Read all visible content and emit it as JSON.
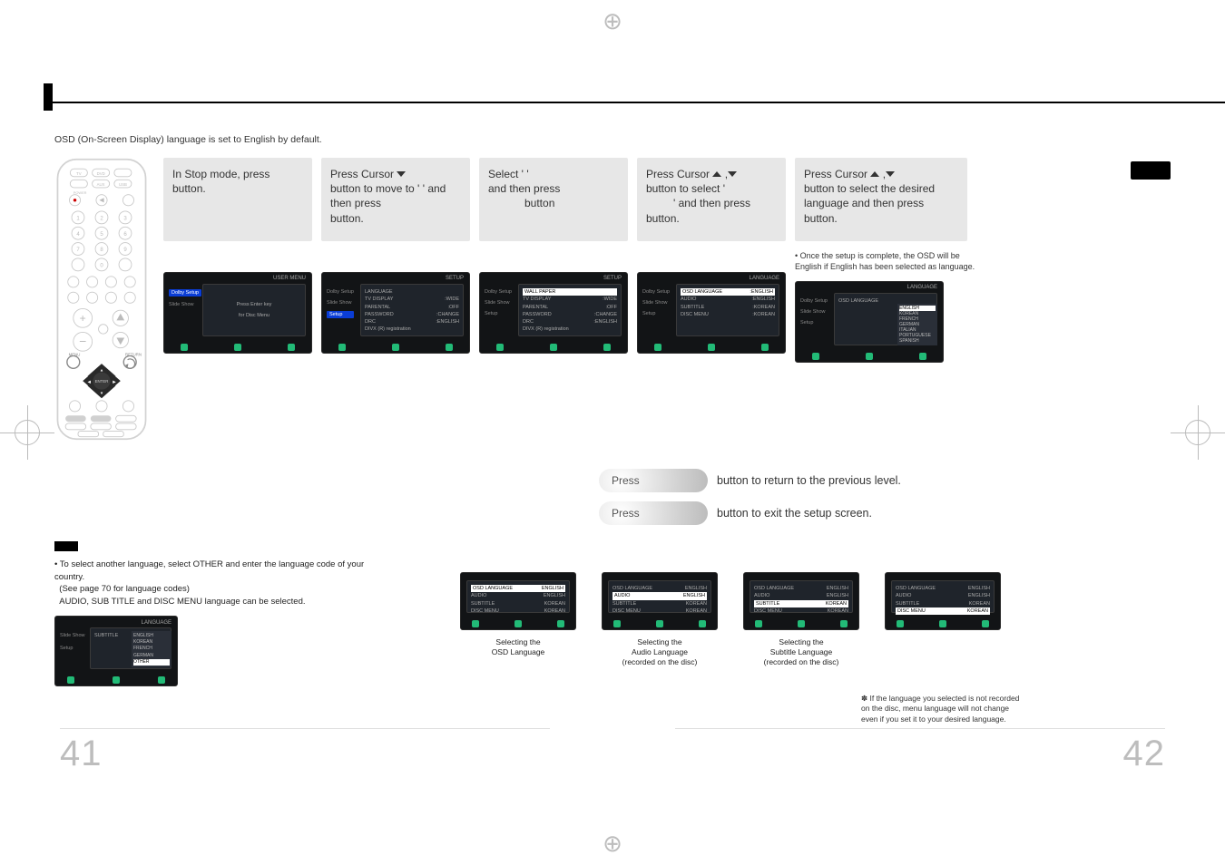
{
  "meta": {
    "defaultNote": "OSD  (On-Screen Display) language is set to English by default."
  },
  "steps": {
    "s1": {
      "t1": "In Stop mode, press",
      "t2": "button."
    },
    "s2": {
      "t1": "Press Cursor",
      "t2": "button to move to '",
      "t3": "' and then press",
      "t4": "button."
    },
    "s3": {
      "t1": "Select '",
      "t2": "'",
      "t3": "and then press",
      "t4": "button"
    },
    "s4": {
      "t1": "Press Cursor",
      "t2": "button to select '",
      "t3": "' and then press",
      "t4": "button."
    },
    "s5": {
      "t1": "Press Cursor",
      "t2": "button to select the desired language and then press",
      "t3": "button."
    }
  },
  "postNote": "•  Once the setup is complete, the OSD will be English if English has been selected as language.",
  "menus": {
    "title_user": "USER MENU",
    "title_setup": "SETUP",
    "title_language": "LANGUAGE",
    "side": {
      "dolby": "Dolby Setup",
      "slide": "Slide Show",
      "setup": "Setup"
    },
    "m1": {
      "a": "Press Enter key",
      "b": "for Disc Menu"
    },
    "m2": {
      "r1a": "LANGUAGE",
      "r2a": "TV DISPLAY",
      "r2b": ":WIDE",
      "r3a": "PARENTAL",
      "r3b": ":OFF",
      "r4a": "PASSWORD",
      "r4b": ":CHANGE",
      "r5a": "DRC",
      "r5b": ":ENGLISH",
      "r6a": "DIVX (R) registration"
    },
    "m3": {
      "r1": "WALL PAPER",
      "r2a": "TV DISPLAY",
      "r2b": ":WIDE",
      "r3a": "PARENTAL",
      "r3b": ":OFF",
      "r4a": "PASSWORD",
      "r4b": ":CHANGE",
      "r5a": "DRC",
      "r5b": ":ENGLISH",
      "r6": "DIVX (R) registration"
    },
    "m4": {
      "r1a": "OSD LANGUAGE",
      "r1b": ":ENGLISH",
      "r2a": "AUDIO",
      "r2b": ":ENGLISH",
      "r3a": "SUBTITLE",
      "r3b": ":KOREAN",
      "r4a": "DISC MENU",
      "r4b": ":KOREAN"
    },
    "m5": {
      "head": "OSD LANGUAGE"
    },
    "langs": [
      "ENGLISH",
      "KOREAN",
      "FRENCH",
      "GERMAN",
      "ITALIAN",
      "PORTUGUESE",
      "SPANISH"
    ],
    "subtitleShot": {
      "head": "SUBTITLE"
    },
    "thumbRows": {
      "r1a": "OSD LANGUAGE",
      "r1b": "ENGLISH",
      "r2a": "AUDIO",
      "r2b": "ENGLISH",
      "r3a": "SUBTITLE",
      "r3b": "KOREAN",
      "r4a": "DISC MENU",
      "r4b": "KOREAN"
    }
  },
  "hints": {
    "pill1": "Press",
    "line1": "button to return to the previous level.",
    "pill2": "Press",
    "line2": "button to exit the setup screen."
  },
  "leftNote": {
    "line1": "To select another language, select OTHER and enter the language code of your country.",
    "line2": "(See page 70 for language codes)",
    "line3": "AUDIO, SUB TITLE and DISC MENU language can be selected."
  },
  "thumbs": {
    "c1a": "Selecting the",
    "c1b": "OSD Language",
    "c2a": "Selecting the",
    "c2b": "Audio Language",
    "c2c": "(recorded on the disc)",
    "c3a": "Selecting the",
    "c3b": "Subtitle Language",
    "c3c": "(recorded on the disc)"
  },
  "warn": "If the language you selected is not recorded on the disc, menu language will not change even if you set it to your desired language.",
  "pageNums": {
    "left": "41",
    "right": "42"
  }
}
